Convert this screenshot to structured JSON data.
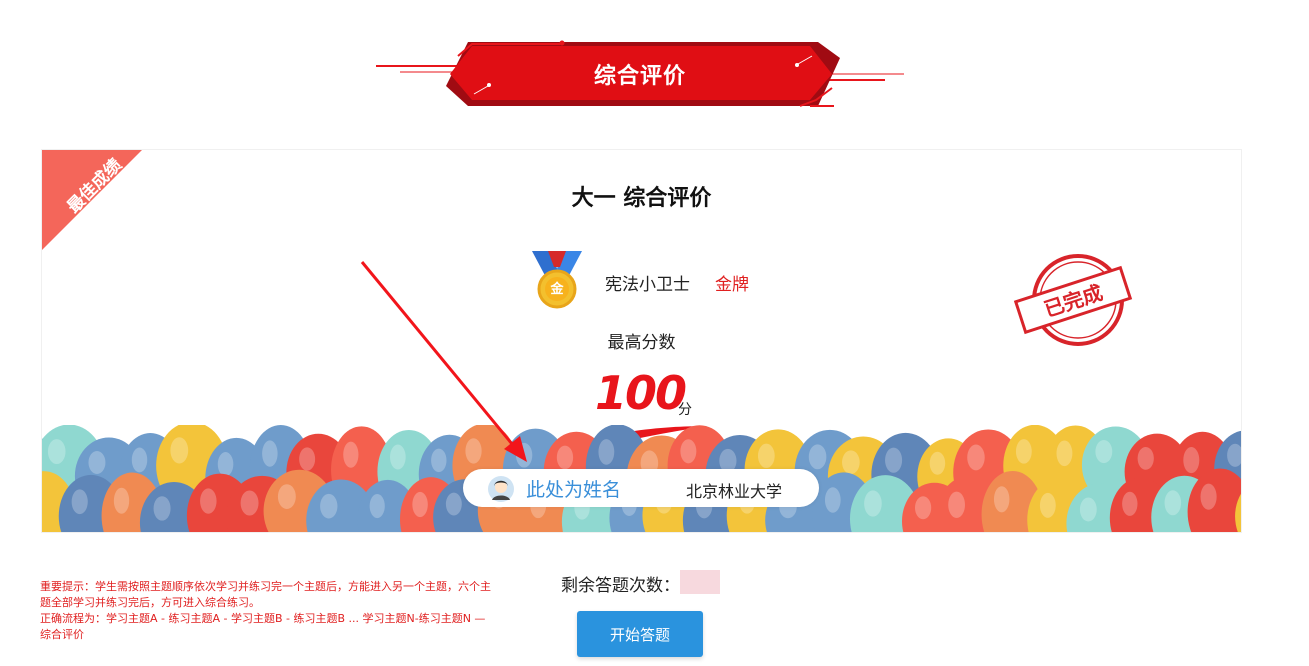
{
  "header": {
    "title": "综合评价"
  },
  "card": {
    "ribbon": "最佳成绩",
    "title": "大一 综合评价",
    "medal": {
      "char": "金",
      "name": "宪法小卫士",
      "level": "金牌"
    },
    "score_label": "最高分数",
    "score_value": "100",
    "score_unit": "分",
    "stamp_text": "已完成",
    "student": {
      "name": "此处为姓名",
      "school": "北京林业大学"
    }
  },
  "notice": {
    "line1": "重要提示：学生需按照主题顺序依次学习并练习完一个主题后，方能进入另一个主题，六个主题全部学习并练习完后，方可进入综合练习。",
    "line2": "正确流程为：学习主题A - 练习主题A - 学习主题B - 练习主题B ... 学习主题N-练习主题N — 综合评价"
  },
  "remaining": {
    "label": "剩余答题次数：",
    "value": ""
  },
  "start_button": "开始答题",
  "colors": {
    "accent": "#e8151b",
    "button": "#2a93de"
  }
}
